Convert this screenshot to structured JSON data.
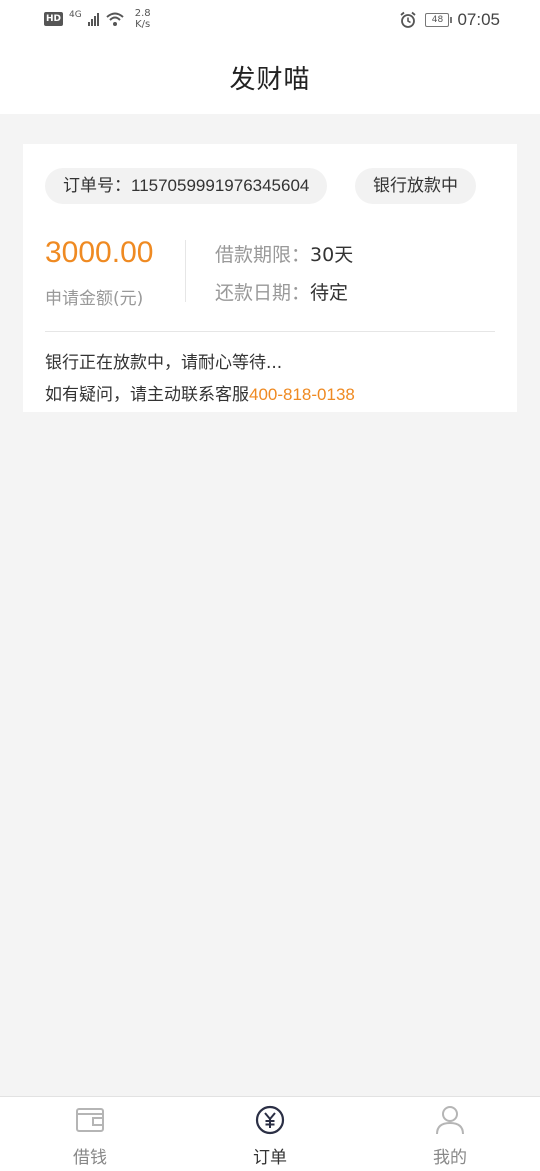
{
  "status_bar": {
    "hd": "HD",
    "network": "4G",
    "speed_value": "2.8",
    "speed_unit": "K/s",
    "battery": "48",
    "time": "07:05"
  },
  "header": {
    "title": "发财喵"
  },
  "order": {
    "order_no_label": "订单号：",
    "order_no": "1157059991976345604",
    "status": "银行放款中",
    "amount": "3000.00",
    "amount_label": "申请金额(元)",
    "term_label": "借款期限：",
    "term_value": "30天",
    "repay_label": "还款日期：",
    "repay_value": "待定",
    "notice": "银行正在放款中，请耐心等待...",
    "contact_text": "如有疑问，请主动联系客服",
    "contact_phone": "400-818-0138"
  },
  "tabs": [
    {
      "label": "借钱",
      "icon": "wallet-icon",
      "active": false
    },
    {
      "label": "订单",
      "icon": "yen-icon",
      "active": true
    },
    {
      "label": "我的",
      "icon": "person-icon",
      "active": false
    }
  ],
  "colors": {
    "accent": "#ef8a22",
    "background": "#f4f4f4",
    "active_tab": "#2b2f45"
  }
}
